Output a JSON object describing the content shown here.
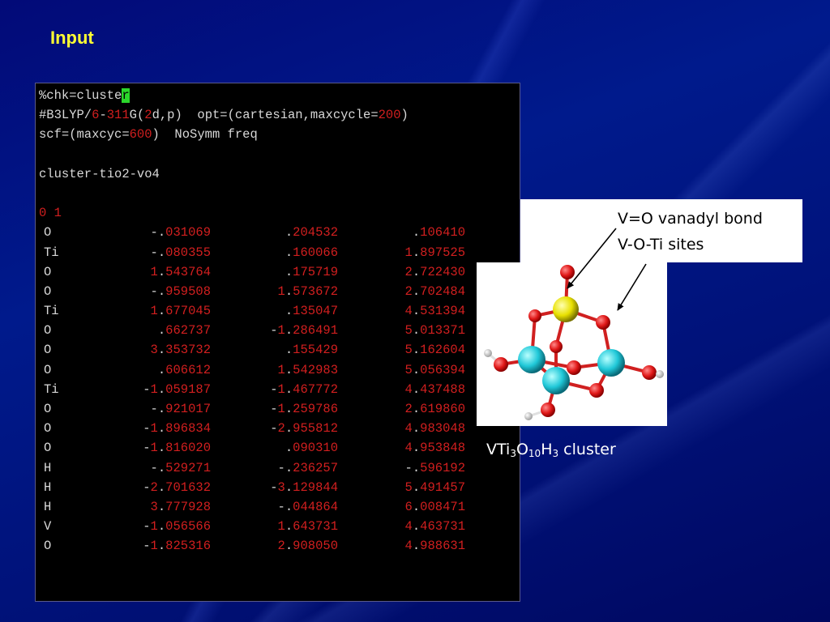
{
  "slide": {
    "title": "Input"
  },
  "terminal": {
    "chk": {
      "text": "%chk=cluste",
      "cursor_char": "r"
    },
    "route": {
      "prefix": "#B3LYP/",
      "basis_a": "6",
      "dash": "-",
      "basis_b": "311",
      "g_open": "G(",
      "d_num": "2",
      "rest": "d,p)  opt=(cartesian,maxcycle=",
      "maxcycle": "200",
      "close": ")"
    },
    "scf": {
      "prefix": "scf=(maxcyc=",
      "maxcyc": "600",
      "suffix": ")  NoSymm freq"
    },
    "title_line": "cluster-tio2-vo4",
    "charge_mult": "0 1",
    "atoms": [
      {
        "el": "O",
        "x": "-.031069",
        "y": ".204532",
        "z": ".106410"
      },
      {
        "el": "Ti",
        "x": "-.080355",
        "y": ".160066",
        "z": "1.897525"
      },
      {
        "el": "O",
        "x": "1.543764",
        "y": ".175719",
        "z": "2.722430"
      },
      {
        "el": "O",
        "x": "-.959508",
        "y": "1.573672",
        "z": "2.702484"
      },
      {
        "el": "Ti",
        "x": "1.677045",
        "y": ".135047",
        "z": "4.531394"
      },
      {
        "el": "O",
        "x": ".662737",
        "y": "-1.286491",
        "z": "5.013371"
      },
      {
        "el": "O",
        "x": "3.353732",
        "y": ".155429",
        "z": "5.162604"
      },
      {
        "el": "O",
        "x": ".606612",
        "y": "1.542983",
        "z": "5.056394"
      },
      {
        "el": "Ti",
        "x": "-1.059187",
        "y": "-1.467772",
        "z": "4.437488"
      },
      {
        "el": "O",
        "x": "-.921017",
        "y": "-1.259786",
        "z": "2.619860"
      },
      {
        "el": "O",
        "x": "-1.896834",
        "y": "-2.955812",
        "z": "4.983048"
      },
      {
        "el": "O",
        "x": "-1.816020",
        "y": ".090310",
        "z": "4.953848"
      },
      {
        "el": "H",
        "x": "-.529271",
        "y": "-.236257",
        "z": "-.596192"
      },
      {
        "el": "H",
        "x": "-2.701632",
        "y": "-3.129844",
        "z": "5.491457"
      },
      {
        "el": "H",
        "x": "3.777928",
        "y": "-.044864",
        "z": "6.008471"
      },
      {
        "el": "V",
        "x": "-1.056566",
        "y": "1.643731",
        "z": "4.463731"
      },
      {
        "el": "O",
        "x": "-1.825316",
        "y": "2.908050",
        "z": "4.988631"
      }
    ]
  },
  "legend": {
    "line1": "V=O vanadyl bond",
    "line2": "V-O-Ti sites"
  },
  "cluster": {
    "prefix": "VTi",
    "sub1": "3",
    "o": "O",
    "sub2": "10",
    "h": "H",
    "sub3": "3",
    "suffix": " cluster"
  },
  "colors": {
    "background": "#00127a",
    "title": "#ffff33",
    "numbers": "#d21f1f",
    "cursor": "#2bd62b",
    "oxygen": "#e01818",
    "titanium": "#20c8d8",
    "vanadium": "#e8e000",
    "hydrogen": "#f0f0f0"
  }
}
